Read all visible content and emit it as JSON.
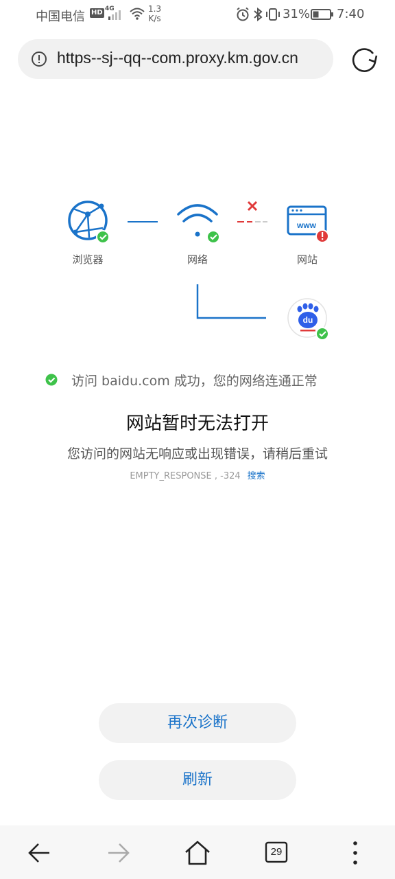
{
  "status_bar": {
    "carrier": "中国电信",
    "hd_badge": "HD",
    "network_type": "4G",
    "speed_value": "1.3",
    "speed_unit": "K/s",
    "battery_percent": "31%",
    "time": "7:40",
    "icons": [
      "signal-icon",
      "wifi-icon",
      "alarm-icon",
      "bluetooth-icon",
      "vibrate-icon",
      "battery-icon"
    ]
  },
  "address_bar": {
    "url": "https--sj--qq--com.proxy.km.gov.cn",
    "info_icon": "info-icon",
    "reload_icon": "reload-icon"
  },
  "diagram": {
    "nodes": [
      {
        "label": "浏览器",
        "icon": "globe-icon",
        "status": "ok"
      },
      {
        "label": "网络",
        "icon": "wifi-icon",
        "status": "ok"
      },
      {
        "label": "网站",
        "icon": "website-icon",
        "status": "error",
        "badge_text": "www"
      }
    ],
    "probe": {
      "icon": "baidu-paw-icon",
      "status": "ok",
      "logo_text": "du"
    },
    "colors": {
      "primary": "#1a73c9",
      "ok": "#3ec24a",
      "error": "#e03a3a"
    }
  },
  "messages": {
    "success": "访问 baidu.com 成功，您的网络连通正常",
    "title": "网站暂时无法打开",
    "description": "您访问的网站无响应或出现错误，请稍后重试",
    "error_code": "EMPTY_RESPONSE , -324",
    "search_link": "搜索"
  },
  "buttons": {
    "diagnose": "再次诊断",
    "refresh": "刷新"
  },
  "bottom_nav": {
    "tabs_count": "29",
    "items": [
      "back-icon",
      "forward-icon",
      "home-icon",
      "tabs-icon",
      "menu-icon"
    ]
  }
}
